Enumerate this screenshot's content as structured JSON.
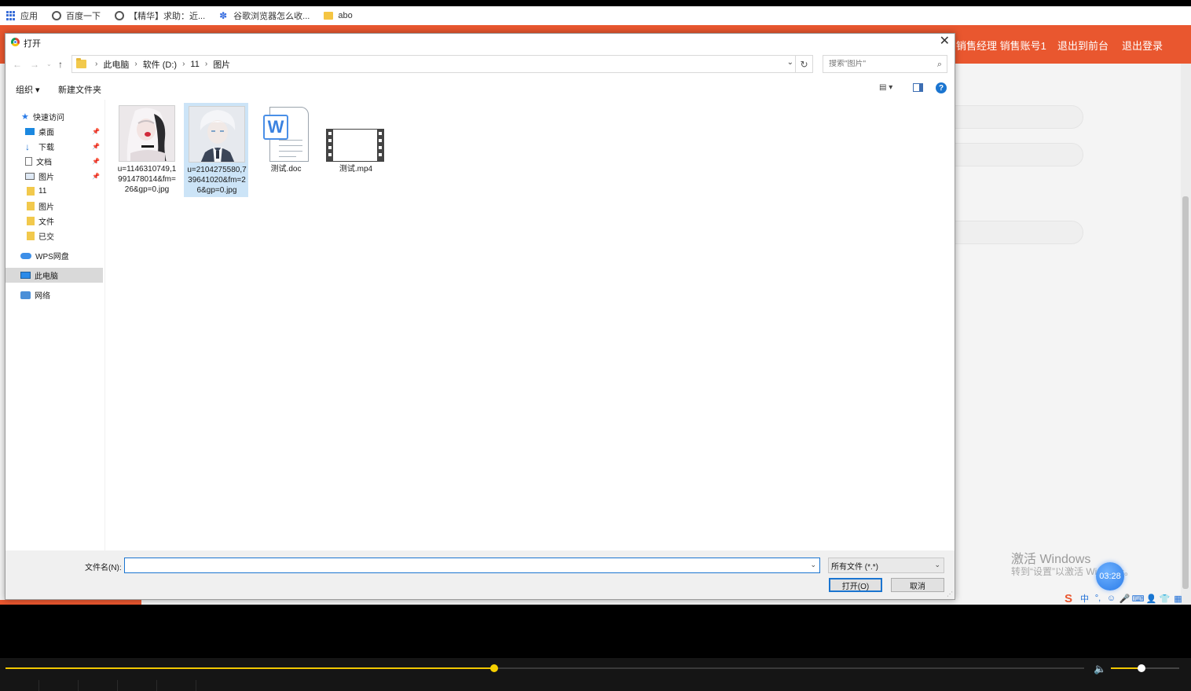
{
  "bookmarks": {
    "items": [
      {
        "label": "应用",
        "icon": "apps-grid-icon"
      },
      {
        "label": "百度一下",
        "icon": "globe-icon"
      },
      {
        "label": "【精华】求助：近...",
        "icon": "globe-icon"
      },
      {
        "label": "谷歌浏览器怎么收...",
        "icon": "baidu-paw-icon"
      },
      {
        "label": "abo",
        "icon": "folder-icon"
      }
    ]
  },
  "webpage": {
    "nav": [
      "销售经理 销售账号1",
      "退出到前台",
      "退出登录"
    ],
    "brand_color": "#e9572f"
  },
  "watermark": {
    "line1": "激活 Windows",
    "line2": "转到“设置”以激活 Windows。",
    "timer": "03:28"
  },
  "ime": [
    "S",
    "中",
    "°,",
    "☺",
    "🎤",
    "⌨",
    "👤",
    "👕",
    "▦"
  ],
  "dialog": {
    "title": "打开",
    "breadcrumb": [
      "此电脑",
      "软件 (D:)",
      "11",
      "图片"
    ],
    "search_placeholder": "搜索\"图片\"",
    "toolbar": {
      "organize": "组织 ▾",
      "new_folder": "新建文件夹"
    },
    "nav": {
      "quick_access": "快速访问",
      "items": [
        {
          "label": "桌面",
          "icon": "desktop-icon",
          "pinned": true
        },
        {
          "label": "下载",
          "icon": "download-icon",
          "pinned": true
        },
        {
          "label": "文档",
          "icon": "document-icon",
          "pinned": true
        },
        {
          "label": "图片",
          "icon": "pictures-icon",
          "pinned": true
        },
        {
          "label": "11",
          "icon": "folder-icon",
          "pinned": false
        },
        {
          "label": "图片",
          "icon": "folder-icon",
          "pinned": false
        },
        {
          "label": "文件",
          "icon": "folder-icon",
          "pinned": false
        },
        {
          "label": "已交",
          "icon": "folder-icon",
          "pinned": false
        }
      ],
      "wps": "WPS网盘",
      "this_pc": "此电脑",
      "network": "网络"
    },
    "files": [
      {
        "name": "u=1146310749,1991478014&fm=26&gp=0.jpg",
        "type": "image"
      },
      {
        "name": "u=2104275580,739641020&fm=26&gp=0.jpg",
        "type": "image",
        "selected": true
      },
      {
        "name": "测试.doc",
        "type": "word"
      },
      {
        "name": "测试.mp4",
        "type": "video"
      }
    ],
    "filename_label": "文件名(N):",
    "filename_value": "",
    "filetype": "所有文件 (*.*)",
    "open_button": "打开(O)",
    "cancel_button": "取消"
  },
  "player": {
    "progress": 0.453,
    "volume": 0.45,
    "accent": "#f1c800"
  }
}
